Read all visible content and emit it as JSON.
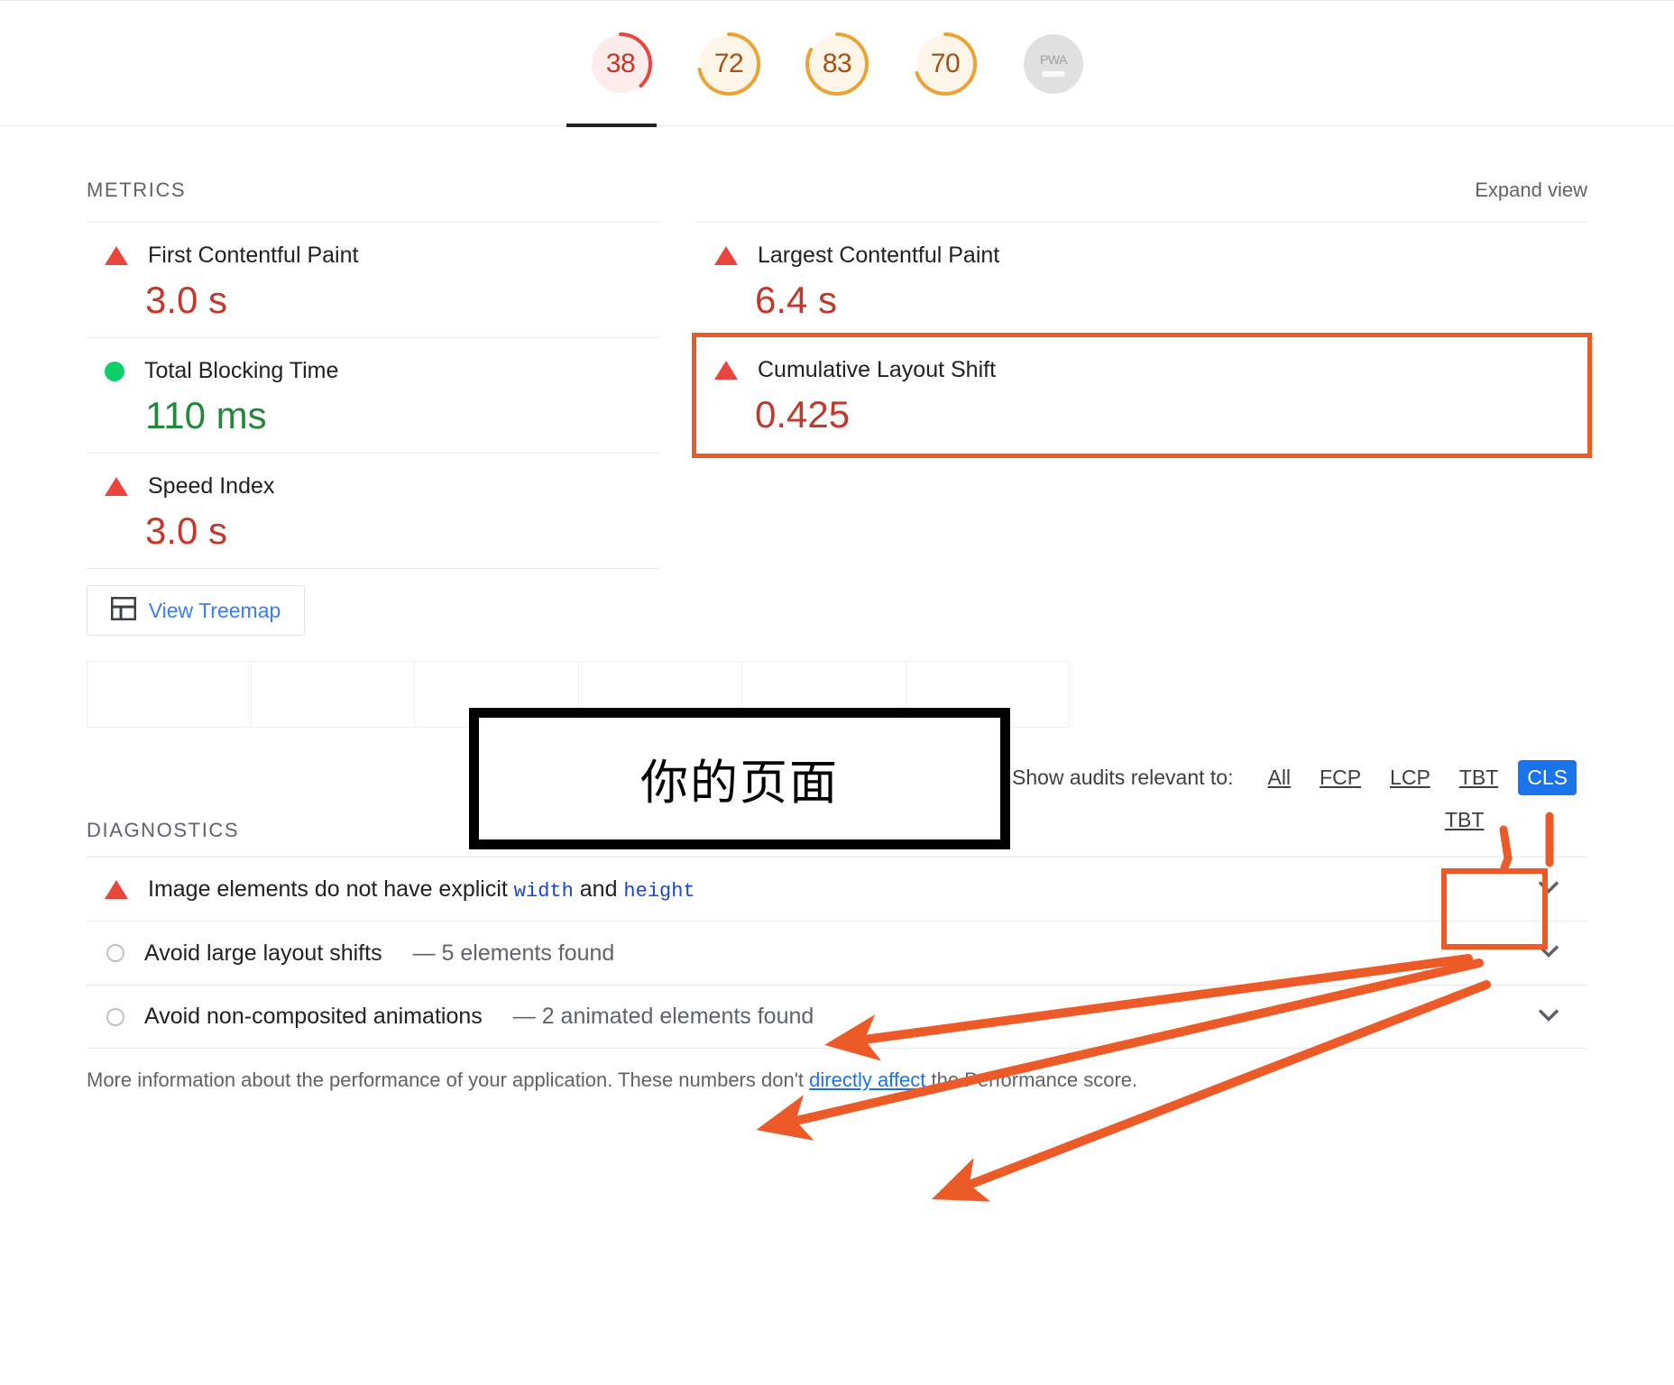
{
  "scores": [
    {
      "name": "performance",
      "value": "38",
      "arc_pct": 38,
      "color": "#e8453c",
      "bg": "#fdeceb",
      "selected": true
    },
    {
      "name": "accessibility",
      "value": "72",
      "arc_pct": 72,
      "color": "#eca336",
      "bg": "#fdf6e8",
      "selected": false
    },
    {
      "name": "best-practices",
      "value": "83",
      "arc_pct": 83,
      "color": "#eca336",
      "bg": "#fdf6e8",
      "selected": false
    },
    {
      "name": "seo",
      "value": "70",
      "arc_pct": 70,
      "color": "#eca336",
      "bg": "#fdf6e8",
      "selected": false
    },
    {
      "name": "pwa",
      "value": "PWA",
      "arc_pct": 0,
      "color": "#9aa0a6",
      "bg": "#e0e0e0",
      "selected": false
    }
  ],
  "metrics_section": {
    "title": "METRICS",
    "expand_label": "Expand view",
    "items": [
      {
        "label": "First Contentful Paint",
        "value": "3.0 s",
        "status": "fail",
        "column": "left"
      },
      {
        "label": "Total Blocking Time",
        "value": "110 ms",
        "status": "pass",
        "column": "left"
      },
      {
        "label": "Speed Index",
        "value": "3.0 s",
        "status": "fail",
        "column": "left"
      },
      {
        "label": "Largest Contentful Paint",
        "value": "6.4 s",
        "status": "fail",
        "column": "right"
      },
      {
        "label": "Cumulative Layout Shift",
        "value": "0.425",
        "status": "fail",
        "column": "right",
        "highlighted": true
      }
    ]
  },
  "treemap": {
    "label": "View Treemap",
    "icon": "treemap-icon"
  },
  "filter": {
    "label": "Show audits relevant to:",
    "chips": [
      {
        "label": "All",
        "selected": false
      },
      {
        "label": "FCP",
        "selected": false
      },
      {
        "label": "LCP",
        "selected": false
      },
      {
        "label": "TBT",
        "selected": false
      },
      {
        "label": "CLS",
        "selected": true
      }
    ],
    "floating_tbt": "TBT"
  },
  "diagnostics": {
    "title": "DIAGNOSTICS",
    "items": [
      {
        "status": "fail",
        "text_before": "Image elements do not have explicit ",
        "code1": "width",
        "text_mid": " and ",
        "code2": "height",
        "sub": ""
      },
      {
        "status": "neutral",
        "text_before": "Avoid large layout shifts",
        "code1": "",
        "text_mid": "",
        "code2": "",
        "sub": "— 5 elements found"
      },
      {
        "status": "neutral",
        "text_before": "Avoid non-composited animations",
        "code1": "",
        "text_mid": "",
        "code2": "",
        "sub": "— 2 animated elements found"
      }
    ]
  },
  "footer": {
    "text_before": "More information about the performance of your application. These numbers don't ",
    "link": "directly affect",
    "text_after": " the Performance score."
  },
  "annotations": {
    "callout_text": "你的页面",
    "box_color": "#000000",
    "arrow_color": "#ec5b27",
    "highlight_color": "#ec5b27"
  },
  "colors": {
    "fail": "#c0392b",
    "pass": "#218739",
    "link": "#1a73e8",
    "accent_orange": "#ec5b27",
    "chip_selected": "#1a73e8"
  }
}
